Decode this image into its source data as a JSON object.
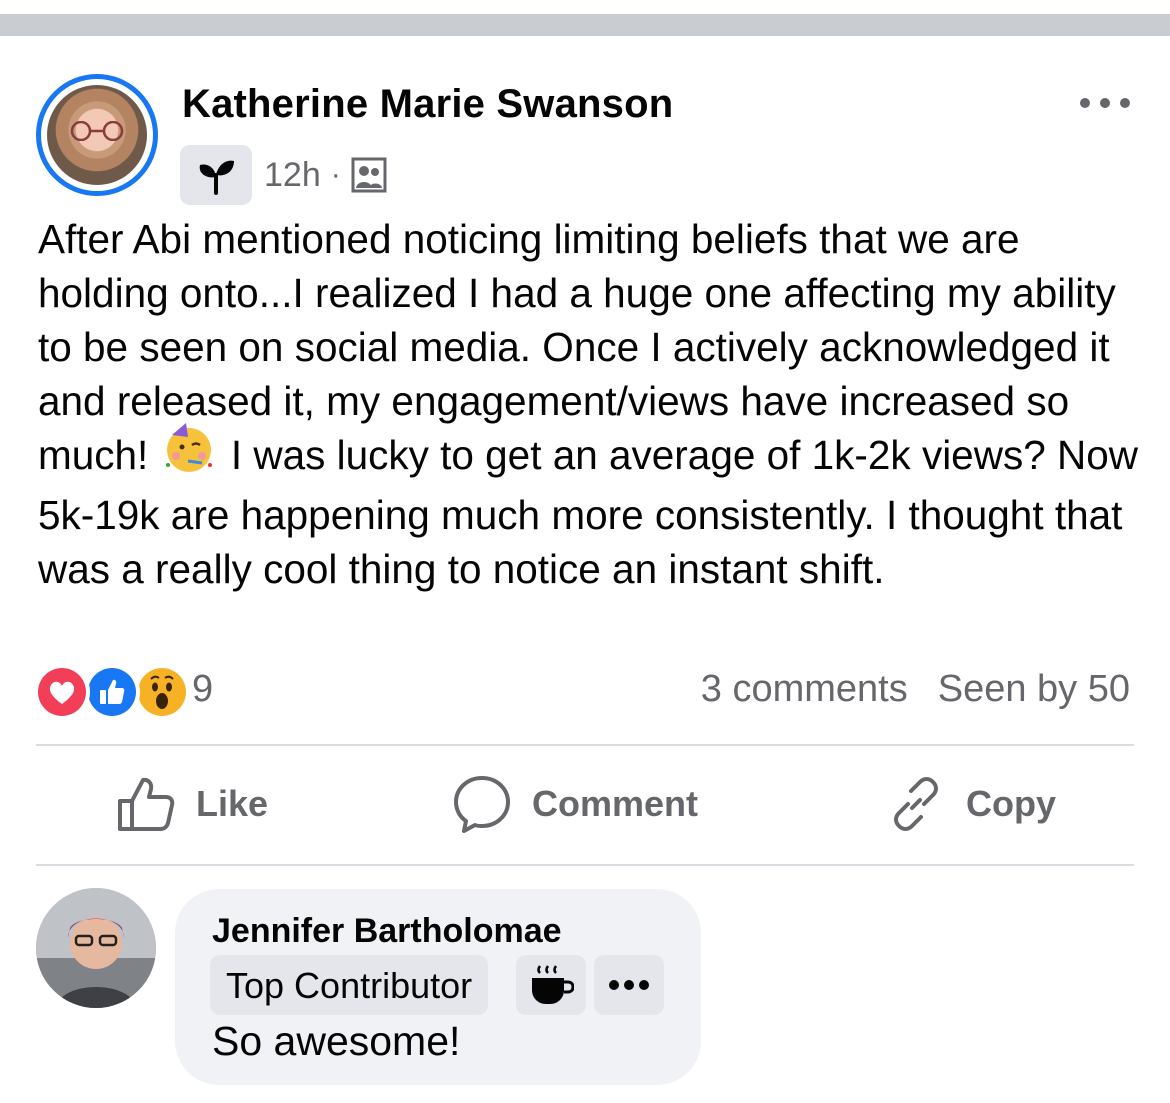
{
  "post": {
    "author": "Katherine Marie Swanson",
    "time": "12h",
    "separator": "·",
    "body": "After Abi mentioned noticing limiting beliefs that we are holding onto...I realized I had a huge one affecting my ability to be seen on social media. Once I actively acknowledged it and released it, my engagement/views have increased so much!",
    "body_after_emoji": "I was lucky to get an average of 1k-2k views? Now 5k-19k are happening much more consistently. I thought that was a really cool thing to notice an instant shift.",
    "reaction_count": "9",
    "comments_count": "3 comments",
    "seen_by": "Seen by 50",
    "reactions": [
      "love",
      "like",
      "wow"
    ]
  },
  "actions": {
    "like": "Like",
    "comment": "Comment",
    "copy": "Copy"
  },
  "comment": {
    "author": "Jennifer Bartholomae",
    "badge": "Top Contributor",
    "text": "So awesome!"
  },
  "colors": {
    "accent": "#1877f2",
    "muted": "#65676b",
    "bubble": "#f0f2f5",
    "chip": "#e4e6eb",
    "love": "#f33e58",
    "like": "#1877f2",
    "wow": "#f7b125"
  },
  "icons": [
    "more-icon",
    "sprout-icon",
    "group-audience-icon",
    "party-face-emoji",
    "like-icon",
    "comment-icon",
    "link-icon",
    "coffee-icon"
  ]
}
